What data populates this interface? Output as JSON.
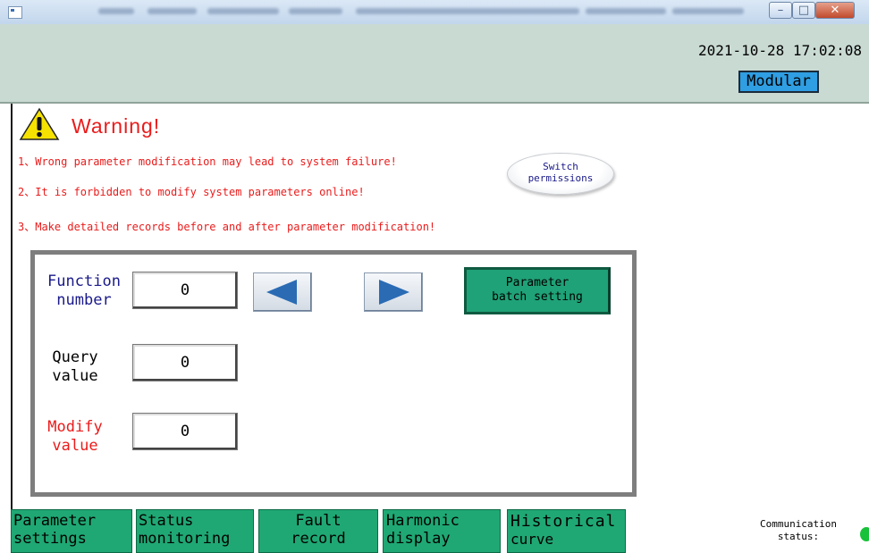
{
  "header": {
    "datetime": "2021-10-28 17:02:08",
    "mode_button": "Modular"
  },
  "warning": {
    "title": "Warning!",
    "lines": [
      "1、Wrong parameter modification may lead to system failure!",
      "2、It is forbidden to modify system parameters online!",
      "3、Make detailed records before and after parameter modification!"
    ],
    "switch_permissions": [
      "Switch",
      "permissions"
    ]
  },
  "panel": {
    "function_number": {
      "label": [
        "Function",
        "number"
      ],
      "value": "0"
    },
    "query_value": {
      "label": [
        "Query",
        "value"
      ],
      "value": "0"
    },
    "modify_value": {
      "label": [
        "Modify",
        "value"
      ],
      "value": "0"
    },
    "batch_button": [
      "Parameter",
      "batch setting"
    ]
  },
  "nav": [
    [
      "Parameter",
      "settings"
    ],
    [
      "Status",
      "monitoring"
    ],
    [
      "Fault",
      "record"
    ],
    [
      "Harmonic",
      "display"
    ],
    [
      "Historical",
      "curve"
    ]
  ],
  "status": {
    "label": [
      "Communication",
      "status:"
    ]
  },
  "colors": {
    "nav_green": "#1fa874",
    "header_bg": "#c9dad3",
    "warning_red": "#ea1b1b",
    "label_blue": "#1a1a8a",
    "accent_blue": "#2f9ee2",
    "status_ok": "#18c13a"
  },
  "icons": [
    "app-icon",
    "warning-icon",
    "left-arrow-icon",
    "right-arrow-icon",
    "status-led-icon"
  ]
}
